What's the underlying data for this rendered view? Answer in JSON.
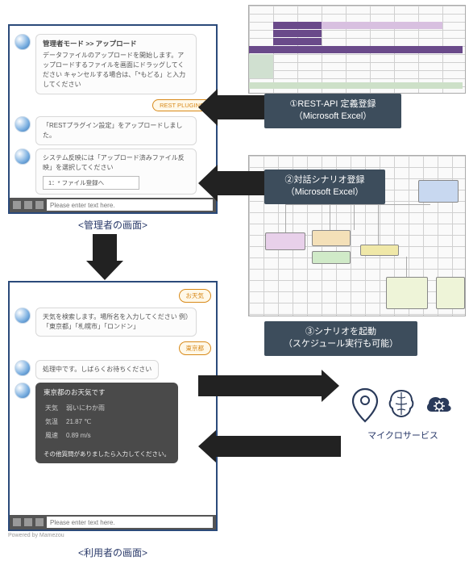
{
  "admin_panel": {
    "header": "管理者モード >> アップロード",
    "msg1": "データファイルのアップロードを開始します。アップロードするファイルを画面にドラッグしてください\nキャンセルする場合は、「*もどる」と入力してください",
    "cancel_link_text": "*もどる",
    "plugin_btn": "REST PLUGINS",
    "msg2": "「RESTプラグイン設定」をアップロードしました。",
    "msg3": "システム反映には「アップロード済みファイル反映」を選択してください",
    "select_text": "1：* ファイル登録へ",
    "input_placeholder": "Please enter text here.",
    "caption": "<管理者の画面>"
  },
  "user_panel": {
    "tag_weather": "お天気",
    "msg1": "天気を検索します。場所名を入力してください\n例）「東京都」「札幌市」「ロンドン」",
    "tag_tokyo": "東京都",
    "msg2": "処理中です。しばらくお待ちください",
    "result_title": "東京都のお天気です",
    "weather": {
      "label_w": "天気",
      "val_w": "弱いにわか雨",
      "label_t": "気温",
      "val_t": "21.87 ℃",
      "label_s": "風速",
      "val_s": "0.89 m/s"
    },
    "result_footer": "その他質問がありましたら入力してください。",
    "input_placeholder": "Please enter text here.",
    "powered": "Powered by Mamezou",
    "caption": "<利用者の画面>"
  },
  "callouts": {
    "c1_line1": "①REST-API 定義登録",
    "c1_line2": "（Microsoft Excel）",
    "c2_line1": "②対話シナリオ登録",
    "c2_line2": "（Microsoft Excel）",
    "c3_line1": "③シナリオを起動",
    "c3_line2": "（スケジュール実行も可能）"
  },
  "microservice": {
    "label": "マイクロサービス"
  },
  "excel1_hint": "REST-API definition sheet",
  "excel2_hint": "Dialog scenario flow sheet"
}
